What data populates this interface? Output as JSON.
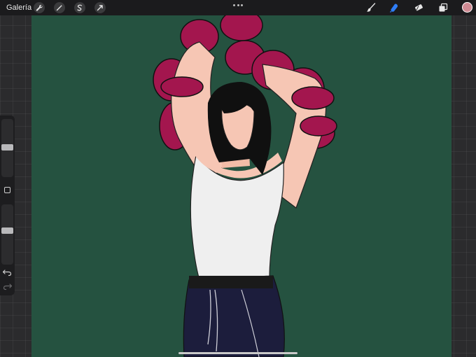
{
  "topbar": {
    "gallery_label": "Galería",
    "left_tools": [
      "wrench-icon",
      "magic-wand-icon",
      "selection-icon",
      "transform-arrow-icon"
    ],
    "right_tools": [
      "brush-icon",
      "smudge-icon",
      "eraser-icon",
      "layers-icon"
    ],
    "active_tool": "smudge-icon"
  },
  "colors": {
    "canvas_background": "#255240",
    "active_color": "#cf8a93",
    "active_tool_highlight": "#2f7df6",
    "tank_top": "#efefef",
    "tentacle": "#a3164e",
    "pants": "#1c1d3c",
    "hair": "#101010",
    "skin": "#f6c6b4"
  },
  "sidebar": {
    "brush_size_level": 0.52,
    "opacity_level": 0.57,
    "buttons": [
      "modify-button",
      "undo-arrow-icon",
      "redo-arrow-icon"
    ]
  }
}
